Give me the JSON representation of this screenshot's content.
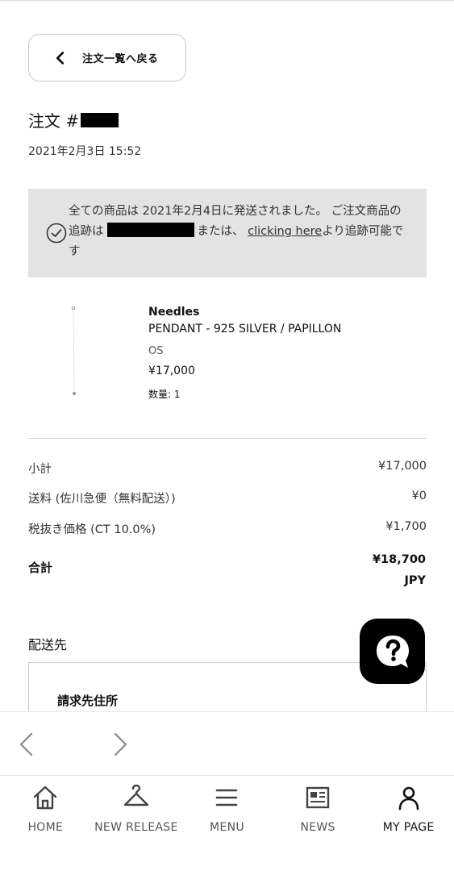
{
  "back_button": {
    "label": "注文一覧へ戻る",
    "icon": "chevron-left-icon"
  },
  "order": {
    "title_prefix": "注文 #",
    "date": "2021年2月3日 15:52"
  },
  "notice": {
    "icon": "check-circle-icon",
    "text_before": "全ての商品は 2021年2月4日に発送されました。 ご注文商品の追跡は",
    "text_middle": "または、",
    "link": "clicking here",
    "text_after": "より追跡可能です"
  },
  "product": {
    "brand": "Needles",
    "name": "PENDANT - 925 SILVER / PAPILLON",
    "size": "OS",
    "price": "¥17,000",
    "quantity": "数量: 1"
  },
  "summary": {
    "subtotal_label": "小計",
    "subtotal_value": "¥17,000",
    "shipping_label": "送料 (佐川急便（無料配送）)",
    "shipping_value": "¥0",
    "tax_label": "税抜き価格 (CT 10.0%)",
    "tax_value": "¥1,700",
    "total_label": "合計",
    "total_value": "¥18,700",
    "currency": "JPY"
  },
  "shipping": {
    "title": "配送先",
    "billing_title": "請求先住所"
  },
  "help": {
    "icon": "question-chat-icon"
  },
  "browser_nav": {
    "back_icon": "chevron-left-icon",
    "forward_icon": "chevron-right-icon"
  },
  "tabbar": {
    "items": [
      {
        "label": "HOME",
        "icon": "home-icon"
      },
      {
        "label": "NEW RELEASE",
        "icon": "hanger-icon"
      },
      {
        "label": "MENU",
        "icon": "menu-icon"
      },
      {
        "label": "NEWS",
        "icon": "newspaper-icon"
      },
      {
        "label": "MY PAGE",
        "icon": "user-icon"
      }
    ],
    "active_index": 4
  }
}
